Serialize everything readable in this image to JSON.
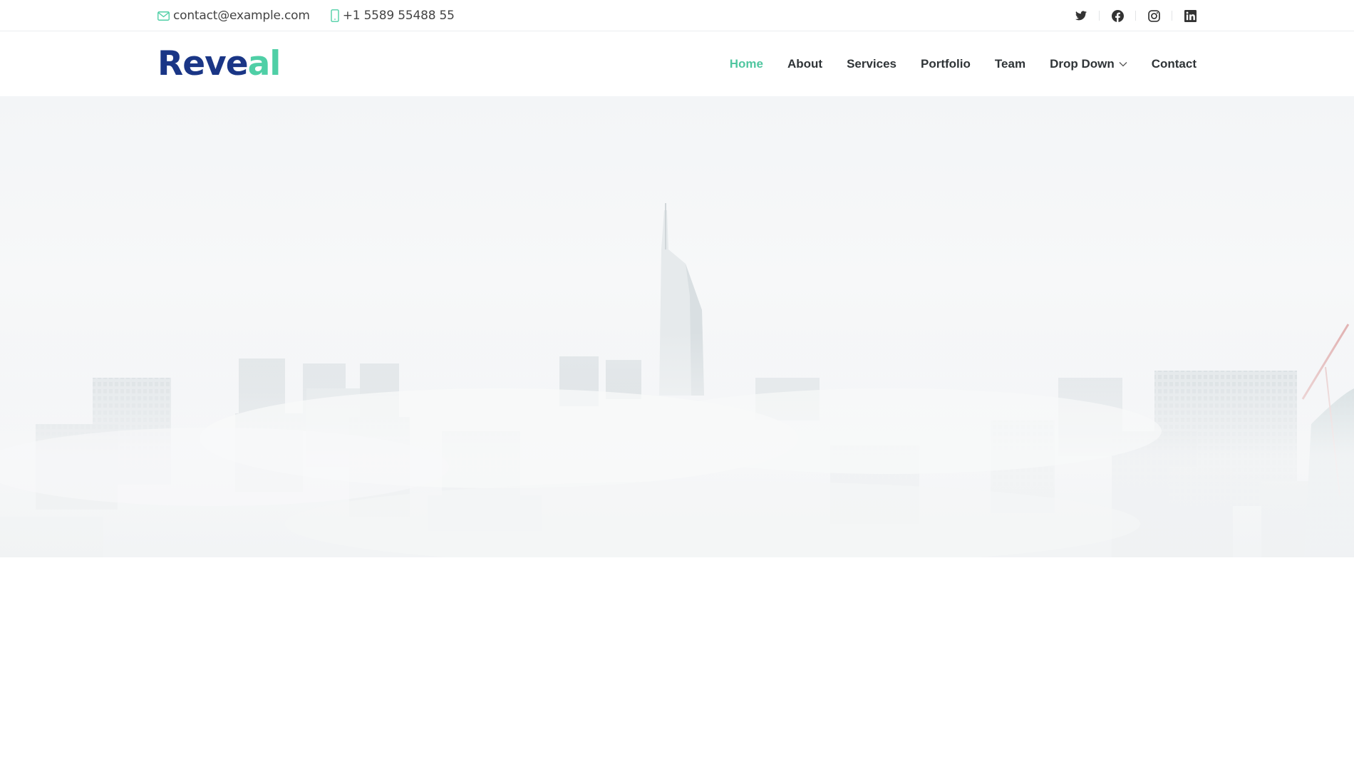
{
  "topbar": {
    "email": "contact@example.com",
    "phone": "+1 5589 55488 55",
    "social": [
      {
        "icon": "twitter-icon"
      },
      {
        "icon": "facebook-icon"
      },
      {
        "icon": "instagram-icon"
      },
      {
        "icon": "linkedin-icon"
      }
    ]
  },
  "header": {
    "logo_main": "Reve",
    "logo_accent": "al",
    "nav": [
      {
        "label": "Home",
        "active": true
      },
      {
        "label": "About"
      },
      {
        "label": "Services"
      },
      {
        "label": "Portfolio"
      },
      {
        "label": "Team"
      },
      {
        "label": "Drop Down",
        "dropdown": true
      },
      {
        "label": "Contact"
      }
    ]
  },
  "colors": {
    "brand": "#1a3686",
    "accent": "#4fcfa6",
    "nav_text": "#2f3437"
  }
}
